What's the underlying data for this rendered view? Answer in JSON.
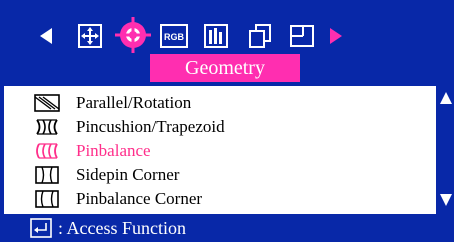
{
  "header": {
    "icons": [
      {
        "name": "nav-left-arrow-icon"
      },
      {
        "name": "position-icon"
      },
      {
        "name": "geometry-icon",
        "selected": true
      },
      {
        "name": "rgb-icon",
        "label": "RGB"
      },
      {
        "name": "color-bars-icon"
      },
      {
        "name": "copy-icon"
      },
      {
        "name": "window-icon"
      },
      {
        "name": "nav-right-arrow-icon"
      }
    ],
    "title": "Geometry"
  },
  "menu": {
    "items": [
      {
        "label": "Parallel/Rotation",
        "selected": false,
        "icon": "parallel-rotation-icon"
      },
      {
        "label": "Pincushion/Trapezoid",
        "selected": false,
        "icon": "pincushion-trapezoid-icon"
      },
      {
        "label": "Pinbalance",
        "selected": true,
        "icon": "pinbalance-icon"
      },
      {
        "label": "Sidepin Corner",
        "selected": false,
        "icon": "sidepin-corner-icon"
      },
      {
        "label": "Pinbalance Corner",
        "selected": false,
        "icon": "pinbalance-corner-icon"
      }
    ]
  },
  "footer": {
    "text": ": Access Function",
    "icon": "enter-key-icon"
  },
  "colors": {
    "background": "#0828a8",
    "accent": "#ff2eb0",
    "selected_text": "#ff2e8a"
  }
}
